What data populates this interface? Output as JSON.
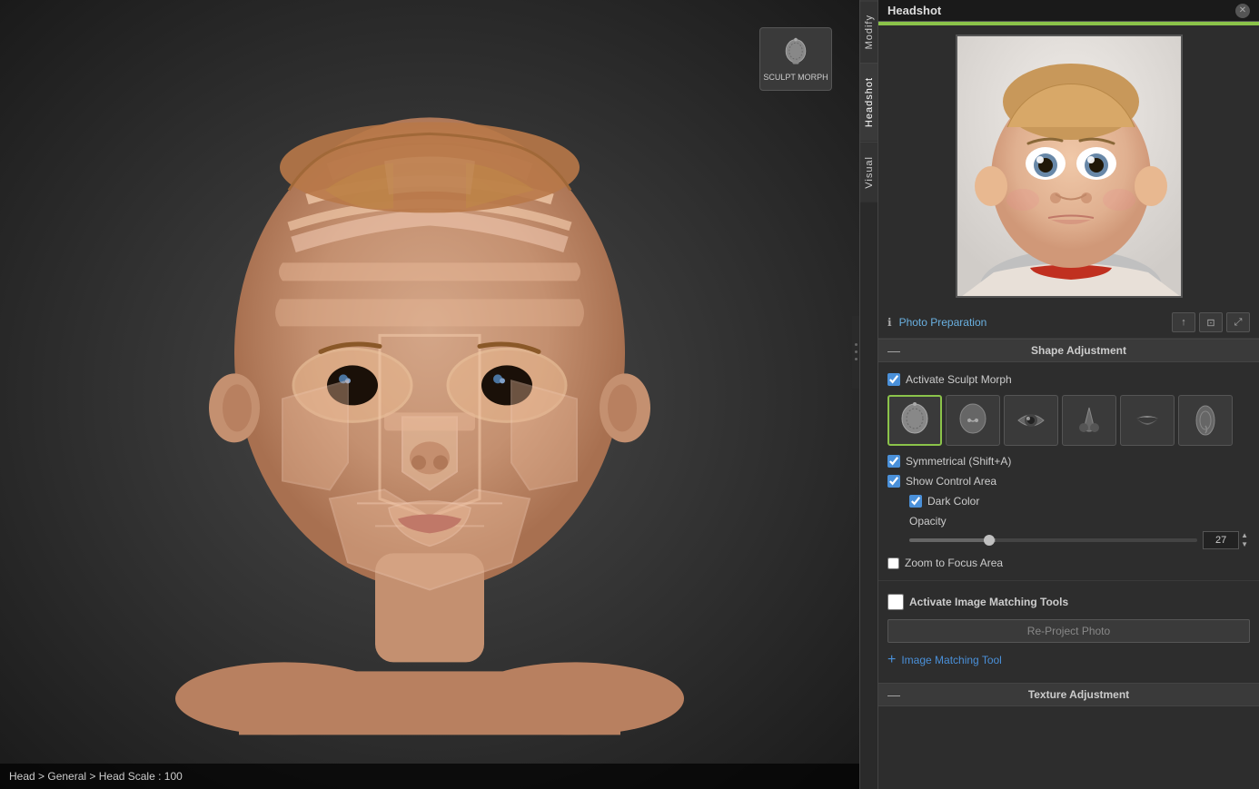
{
  "app": {
    "title": "Headshot"
  },
  "tabs": {
    "modify": "Modify",
    "headshot": "Headshot",
    "visual": "Visual"
  },
  "photo_prep": {
    "label": "Photo Preparation"
  },
  "shape_adjustment": {
    "title": "Shape Adjustment",
    "activate_sculpt_morph": "Activate Sculpt Morph",
    "symmetrical": "Symmetrical (Shift+A)",
    "show_control_area": "Show Control Area",
    "dark_color": "Dark Color",
    "opacity_label": "Opacity",
    "opacity_value": "27",
    "zoom_to_focus": "Zoom to Focus Area"
  },
  "image_matching": {
    "activate_label": "Activate Image Matching Tools",
    "re_project_label": "Re-Project Photo",
    "add_tool_label": "Image Matching Tool"
  },
  "texture_adjustment": {
    "title": "Texture Adjustment"
  },
  "status_bar": {
    "text": "Head > General > Head Scale : 100"
  },
  "sculpt_morph_btn": {
    "label": "SCULPT MORPH"
  },
  "morph_types": [
    {
      "id": "head",
      "selected": true
    },
    {
      "id": "nose-bridge",
      "selected": false
    },
    {
      "id": "eye",
      "selected": false
    },
    {
      "id": "nose-tip",
      "selected": false
    },
    {
      "id": "lips",
      "selected": false
    },
    {
      "id": "ear",
      "selected": false
    }
  ]
}
